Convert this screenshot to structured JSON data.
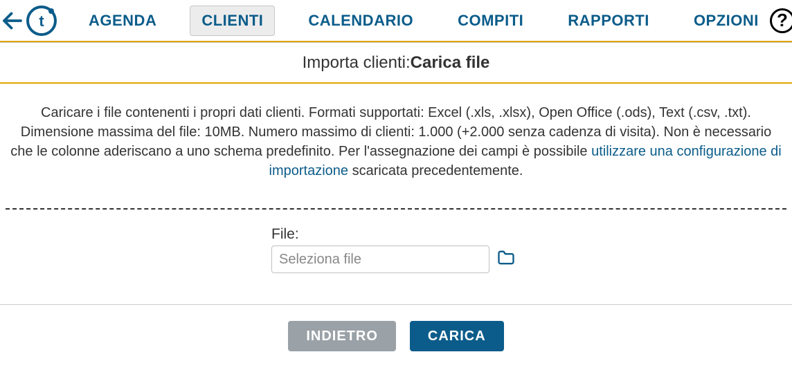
{
  "nav": {
    "items": [
      {
        "label": "AGENDA"
      },
      {
        "label": "CLIENTI"
      },
      {
        "label": "CALENDARIO"
      },
      {
        "label": "COMPITI"
      },
      {
        "label": "RAPPORTI"
      },
      {
        "label": "OPZIONI"
      }
    ],
    "active_index": 1,
    "help_symbol": "?"
  },
  "title": {
    "prefix": "Importa clienti: ",
    "bold": "Carica file"
  },
  "instructions": {
    "part1": "Caricare i file contenenti i propri dati clienti. Formati supportati: Excel (.xls, .xlsx), Open Office (.ods), Text (.csv, .txt). Dimensione massima del file: 10MB. Numero massimo di clienti: 1.000 (+2.000 senza cadenza di visita). Non è necessario che le colonne aderiscano a uno schema predefinito. Per l'assegnazione dei campi è possibile ",
    "link": "utilizzare una configurazione di importazione",
    "part2": " scaricata precedentemente."
  },
  "file": {
    "label": "File:",
    "placeholder": "Seleziona file"
  },
  "buttons": {
    "back": "INDIETRO",
    "load": "CARICA"
  }
}
